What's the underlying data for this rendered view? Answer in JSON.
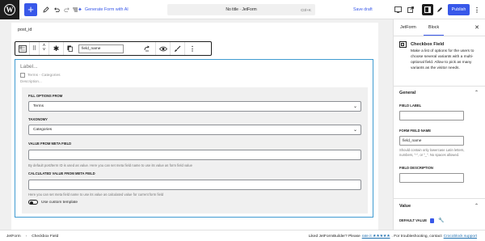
{
  "topbar": {
    "add_label": "+",
    "undo_icon": "undo-icon",
    "redo_icon": "redo-icon",
    "list_view_icon": "list-view-icon",
    "generate_ai": "Generate Form with AI",
    "doc_title": "No title · JetForm",
    "shortcut": "Ctrl+K",
    "save_draft": "Save draft",
    "publish": "Publish"
  },
  "editor": {
    "post_id": "post_id",
    "toolbar": {
      "field_name": "field_name"
    },
    "block": {
      "label_placeholder": "Label...",
      "checkbox_text": "Terms - Categories",
      "description_placeholder": "Description...",
      "fill_options_label": "FILL OPTIONS FROM",
      "fill_options_value": "Terms",
      "taxonomy_label": "TAXONOMY",
      "taxonomy_value": "Categories",
      "meta_field_label": "VALUE FROM META FIELD",
      "meta_field_help": "By default post/term ID is used as value. Here you can set meta field name to use its value as form field value",
      "calc_meta_label": "CALCULATED VALUE FROM META FIELD",
      "calc_meta_help": "Here you can set meta field name to use its value as calculated value for current form field",
      "custom_template_label": "Use custom template"
    }
  },
  "sidebar": {
    "tabs": [
      "JetForm",
      "Block"
    ],
    "active_tab": "Block",
    "block_title": "Checkbox Field",
    "block_description": "Make a list of options for the users to choose several variants with a multi-optional field. Allow to pick as many variants as the visitor needs.",
    "general_title": "General",
    "field_label_label": "FIELD LABEL",
    "field_label_value": "",
    "form_field_name_label": "FORM FIELD NAME",
    "form_field_name_value": "field_name",
    "field_name_help": "Should contain only lowercase Latin letters, numbers, \"-\", or \"_\". No spaces allowed.",
    "field_description_label": "FIELD DESCRIPTION",
    "value_title": "Value",
    "default_value_label": "DEFAULT VALUE"
  },
  "footer": {
    "breadcrumb": [
      "JetForm",
      "Checkbox Field"
    ],
    "message_prefix": "Liked JetFormBuilder? Please",
    "rate_link": "rate it ★★★★★",
    "message_mid": ". For troubleshooting, contact",
    "support_link": "Crocoblock support"
  },
  "colors": {
    "accent": "#3858e9",
    "selected_border": "#3f9bd1",
    "dark": "#1e1e1e"
  }
}
